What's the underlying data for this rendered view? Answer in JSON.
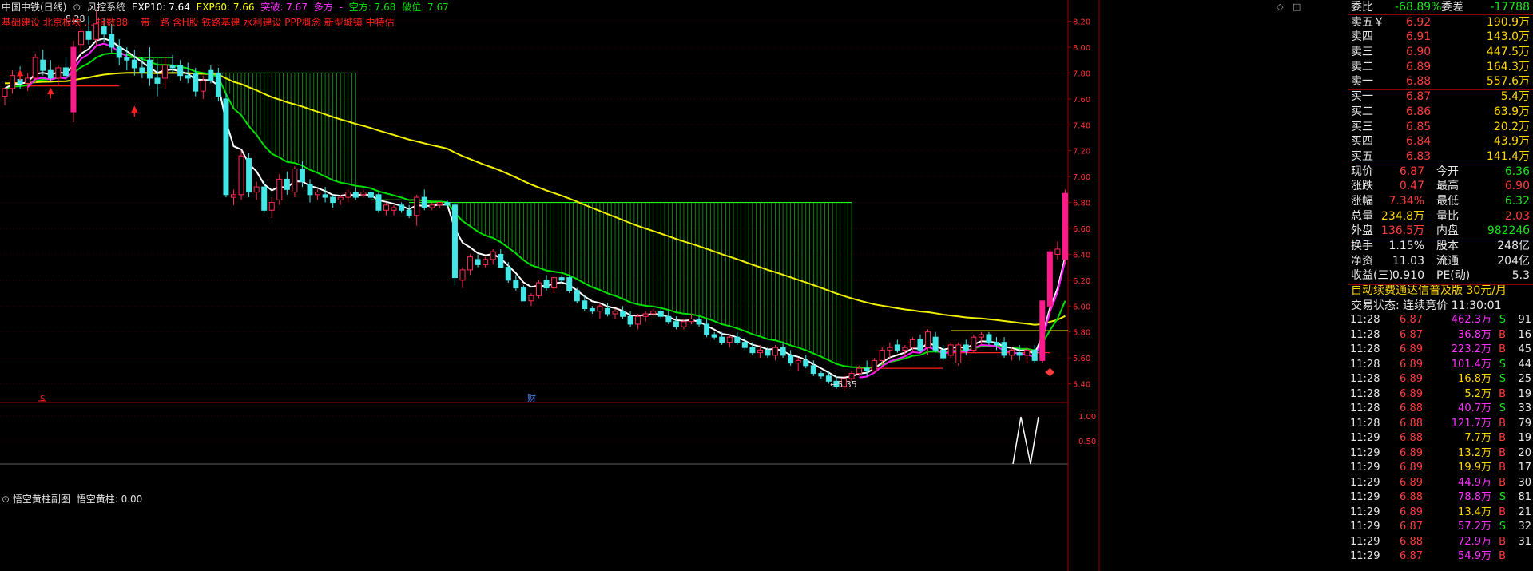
{
  "header": {
    "symbol": "中国中铁(日线)",
    "system": "风控系统",
    "exp10": "EXP10: 7.64",
    "exp60": "EXP60: 7.66",
    "breakout": "突破: 7.67",
    "bull": "多方",
    "dash": "-",
    "bear": "空方: 7.68",
    "broken": "破位: 7.67"
  },
  "concepts": "基础建设 北京板块 ... 指数88 一带一路 含H股 铁路基建 水利建设 PPP概念 新型城镇 中特估",
  "subchart": {
    "name": "悟空黄柱副图",
    "indicator": "悟空黄柱: 0.00"
  },
  "marks": {
    "s_marker": "S",
    "cai_marker": "财",
    "low_label": "←5.35",
    "high_label": "8.28"
  },
  "axis": {
    "main_ticks": [
      "8.20",
      "8.00",
      "7.80",
      "7.60",
      "7.40",
      "7.20",
      "7.00",
      "6.80",
      "6.60",
      "6.40",
      "6.20",
      "6.00",
      "5.80",
      "5.60",
      "5.40"
    ],
    "sub_ticks": [
      "1.00",
      "0.50"
    ]
  },
  "panel": {
    "weibi": {
      "label": "委比",
      "value": "-68.89%",
      "label2": "委差",
      "value2": "-17788"
    },
    "asks": [
      {
        "label": "卖五￥",
        "price": "6.92",
        "vol": "190.9万"
      },
      {
        "label": "卖四",
        "price": "6.91",
        "vol": "143.0万"
      },
      {
        "label": "卖三",
        "price": "6.90",
        "vol": "447.5万"
      },
      {
        "label": "卖二",
        "price": "6.89",
        "vol": "164.3万"
      },
      {
        "label": "卖一",
        "price": "6.88",
        "vol": "557.6万"
      }
    ],
    "bids": [
      {
        "label": "买一",
        "price": "6.87",
        "vol": "5.4万"
      },
      {
        "label": "买二",
        "price": "6.86",
        "vol": "63.9万"
      },
      {
        "label": "买三",
        "price": "6.85",
        "vol": "20.2万"
      },
      {
        "label": "买四",
        "price": "6.84",
        "vol": "43.9万"
      },
      {
        "label": "买五",
        "price": "6.83",
        "vol": "141.4万"
      }
    ],
    "quote": [
      {
        "l1": "现价",
        "v1": "6.87",
        "c1": "red",
        "l2": "今开",
        "v2": "6.36",
        "c2": "green"
      },
      {
        "l1": "涨跌",
        "v1": "0.47",
        "c1": "red",
        "l2": "最高",
        "v2": "6.90",
        "c2": "red"
      },
      {
        "l1": "涨幅",
        "v1": "7.34%",
        "c1": "red",
        "l2": "最低",
        "v2": "6.32",
        "c2": "green"
      },
      {
        "l1": "总量",
        "v1": "234.8万",
        "c1": "yellow",
        "l2": "量比",
        "v2": "2.03",
        "c2": "red"
      },
      {
        "l1": "外盘",
        "v1": "136.5万",
        "c1": "red",
        "l2": "内盘",
        "v2": "98224б",
        "c2": "green"
      }
    ],
    "fund": [
      {
        "l1": "换手",
        "v1": "1.15%",
        "l2": "股本",
        "v2": "248亿"
      },
      {
        "l1": "净资",
        "v1": "11.03",
        "l2": "流通",
        "v2": "204亿"
      },
      {
        "l1": "收益(三)",
        "v1": "0.910",
        "l2": "PE(动)",
        "v2": "5.3"
      }
    ],
    "promo": "自动续费通达信普及版  30元/月",
    "status": "交易状态: 连续竞价 11:30:01",
    "trades": [
      {
        "t": "11:28",
        "p": "6.87",
        "v": "462.3万",
        "s": "S",
        "n": "91",
        "vc": "mag"
      },
      {
        "t": "11:28",
        "p": "6.87",
        "v": "36.8万",
        "s": "B",
        "n": "16",
        "vc": "mag"
      },
      {
        "t": "11:28",
        "p": "6.89",
        "v": "223.2万",
        "s": "B",
        "n": "45",
        "vc": "mag"
      },
      {
        "t": "11:28",
        "p": "6.89",
        "v": "101.4万",
        "s": "S",
        "n": "44",
        "vc": "mag"
      },
      {
        "t": "11:28",
        "p": "6.89",
        "v": "16.8万",
        "s": "S",
        "n": "25",
        "vc": "yellow"
      },
      {
        "t": "11:28",
        "p": "6.89",
        "v": "5.2万",
        "s": "B",
        "n": "19",
        "vc": "yellow"
      },
      {
        "t": "11:28",
        "p": "6.88",
        "v": "40.7万",
        "s": "S",
        "n": "33",
        "vc": "mag"
      },
      {
        "t": "11:28",
        "p": "6.88",
        "v": "121.7万",
        "s": "B",
        "n": "79",
        "vc": "mag"
      },
      {
        "t": "11:29",
        "p": "6.88",
        "v": "7.7万",
        "s": "B",
        "n": "19",
        "vc": "yellow"
      },
      {
        "t": "11:29",
        "p": "6.89",
        "v": "13.2万",
        "s": "B",
        "n": "20",
        "vc": "yellow"
      },
      {
        "t": "11:29",
        "p": "6.89",
        "v": "19.9万",
        "s": "B",
        "n": "17",
        "vc": "yellow"
      },
      {
        "t": "11:29",
        "p": "6.89",
        "v": "44.9万",
        "s": "B",
        "n": "30",
        "vc": "mag"
      },
      {
        "t": "11:29",
        "p": "6.88",
        "v": "78.8万",
        "s": "S",
        "n": "81",
        "vc": "mag"
      },
      {
        "t": "11:29",
        "p": "6.89",
        "v": "13.4万",
        "s": "B",
        "n": "21",
        "vc": "yellow"
      },
      {
        "t": "11:29",
        "p": "6.87",
        "v": "57.2万",
        "s": "S",
        "n": "32",
        "vc": "mag"
      },
      {
        "t": "11:29",
        "p": "6.88",
        "v": "72.9万",
        "s": "B",
        "n": "31",
        "vc": "mag"
      },
      {
        "t": "11:29",
        "p": "6.87",
        "v": "54.9万",
        "s": "B",
        "n": "",
        "vc": "mag"
      }
    ]
  },
  "chart_data": {
    "type": "candlestick",
    "y_range": [
      5.28,
      8.29
    ],
    "last_close": 6.87,
    "candles": [
      [
        7.62,
        7.68,
        7.55,
        7.68
      ],
      [
        7.68,
        7.82,
        7.64,
        7.78
      ],
      [
        7.75,
        7.85,
        7.68,
        7.72
      ],
      [
        7.72,
        7.8,
        7.66,
        7.76
      ],
      [
        7.76,
        7.95,
        7.72,
        7.92
      ],
      [
        7.9,
        7.98,
        7.78,
        7.82
      ],
      [
        7.82,
        7.9,
        7.74,
        7.76
      ],
      [
        7.76,
        7.86,
        7.7,
        7.84
      ],
      [
        7.84,
        7.92,
        7.76,
        7.78
      ],
      [
        7.5,
        8.05,
        7.42,
        8.0
      ],
      [
        8.02,
        8.18,
        7.96,
        8.12
      ],
      [
        8.12,
        8.24,
        8.02,
        8.06
      ],
      [
        8.06,
        8.28,
        8.0,
        8.18
      ],
      [
        8.16,
        8.22,
        8.04,
        8.1
      ],
      [
        8.1,
        8.18,
        7.96,
        8.0
      ],
      [
        8.0,
        8.06,
        7.86,
        7.92
      ],
      [
        7.92,
        8.0,
        7.82,
        7.9
      ],
      [
        7.9,
        7.98,
        7.78,
        7.84
      ],
      [
        7.84,
        7.92,
        7.76,
        7.8
      ],
      [
        7.9,
        8.0,
        7.7,
        7.76
      ],
      [
        7.76,
        7.88,
        7.62,
        7.72
      ],
      [
        7.76,
        7.92,
        7.68,
        7.86
      ],
      [
        7.86,
        7.94,
        7.8,
        7.84
      ],
      [
        7.86,
        7.9,
        7.74,
        7.78
      ],
      [
        7.78,
        7.88,
        7.72,
        7.76
      ],
      [
        7.8,
        7.84,
        7.62,
        7.66
      ],
      [
        7.66,
        7.78,
        7.6,
        7.74
      ],
      [
        7.82,
        7.86,
        7.72,
        7.74
      ],
      [
        7.8,
        7.84,
        7.58,
        7.62
      ],
      [
        7.6,
        7.64,
        6.84,
        6.86
      ],
      [
        6.84,
        6.9,
        6.78,
        6.86
      ],
      [
        6.86,
        7.2,
        6.82,
        7.16
      ],
      [
        7.14,
        7.18,
        6.84,
        6.88
      ],
      [
        6.88,
        6.96,
        6.82,
        6.92
      ],
      [
        6.92,
        6.96,
        6.72,
        6.74
      ],
      [
        6.74,
        6.84,
        6.68,
        6.8
      ],
      [
        6.82,
        7.02,
        6.78,
        6.98
      ],
      [
        6.98,
        7.04,
        6.86,
        6.9
      ],
      [
        6.88,
        7.08,
        6.84,
        7.06
      ],
      [
        7.06,
        7.12,
        6.92,
        6.96
      ],
      [
        6.94,
        6.98,
        6.8,
        6.86
      ],
      [
        6.86,
        6.9,
        6.82,
        6.88
      ],
      [
        6.86,
        6.92,
        6.8,
        6.84
      ],
      [
        6.84,
        6.86,
        6.76,
        6.8
      ],
      [
        6.82,
        6.86,
        6.78,
        6.84
      ],
      [
        6.84,
        6.9,
        6.8,
        6.88
      ],
      [
        6.88,
        6.92,
        6.82,
        6.84
      ],
      [
        6.86,
        6.9,
        6.84,
        6.88
      ],
      [
        6.88,
        6.9,
        6.82,
        6.84
      ],
      [
        6.86,
        6.88,
        6.72,
        6.74
      ],
      [
        6.74,
        6.8,
        6.7,
        6.78
      ],
      [
        6.74,
        6.78,
        6.7,
        6.76
      ],
      [
        6.78,
        6.8,
        6.72,
        6.74
      ],
      [
        6.74,
        6.78,
        6.68,
        6.7
      ],
      [
        6.7,
        6.86,
        6.62,
        6.84
      ],
      [
        6.84,
        6.9,
        6.74,
        6.76
      ],
      [
        6.76,
        6.8,
        6.74,
        6.78
      ],
      [
        6.78,
        6.8,
        6.76,
        6.8
      ],
      [
        6.8,
        6.82,
        6.76,
        6.78
      ],
      [
        6.78,
        6.8,
        6.16,
        6.22
      ],
      [
        6.2,
        6.3,
        6.14,
        6.28
      ],
      [
        6.28,
        6.4,
        6.24,
        6.38
      ],
      [
        6.36,
        6.4,
        6.3,
        6.32
      ],
      [
        6.32,
        6.38,
        6.3,
        6.36
      ],
      [
        6.36,
        6.44,
        6.32,
        6.42
      ],
      [
        6.4,
        6.44,
        6.3,
        6.3
      ],
      [
        6.3,
        6.34,
        6.18,
        6.2
      ],
      [
        6.2,
        6.24,
        6.12,
        6.14
      ],
      [
        6.14,
        6.16,
        6.04,
        6.04
      ],
      [
        6.04,
        6.1,
        6.0,
        6.08
      ],
      [
        6.08,
        6.2,
        6.06,
        6.18
      ],
      [
        6.2,
        6.24,
        6.12,
        6.14
      ],
      [
        6.14,
        6.24,
        6.1,
        6.22
      ],
      [
        6.22,
        6.24,
        6.18,
        6.2
      ],
      [
        6.22,
        6.24,
        6.1,
        6.12
      ],
      [
        6.12,
        6.14,
        6.02,
        6.04
      ],
      [
        6.04,
        6.08,
        5.96,
        5.98
      ],
      [
        5.98,
        6.0,
        5.94,
        5.96
      ],
      [
        5.96,
        6.02,
        5.9,
        6.0
      ],
      [
        5.98,
        6.02,
        5.92,
        5.94
      ],
      [
        5.94,
        5.98,
        5.9,
        5.96
      ],
      [
        5.96,
        6.0,
        5.9,
        5.92
      ],
      [
        5.92,
        5.96,
        5.84,
        5.86
      ],
      [
        5.86,
        5.94,
        5.82,
        5.92
      ],
      [
        5.92,
        5.96,
        5.88,
        5.94
      ],
      [
        5.94,
        5.98,
        5.92,
        5.96
      ],
      [
        5.96,
        5.98,
        5.9,
        5.92
      ],
      [
        5.92,
        5.96,
        5.86,
        5.88
      ],
      [
        5.88,
        5.92,
        5.82,
        5.84
      ],
      [
        5.84,
        5.9,
        5.82,
        5.88
      ],
      [
        5.88,
        5.94,
        5.86,
        5.9
      ],
      [
        5.9,
        5.92,
        5.84,
        5.86
      ],
      [
        5.86,
        5.9,
        5.76,
        5.78
      ],
      [
        5.78,
        5.8,
        5.74,
        5.76
      ],
      [
        5.76,
        5.8,
        5.7,
        5.72
      ],
      [
        5.72,
        5.78,
        5.68,
        5.76
      ],
      [
        5.76,
        5.8,
        5.7,
        5.72
      ],
      [
        5.72,
        5.76,
        5.66,
        5.68
      ],
      [
        5.68,
        5.72,
        5.62,
        5.64
      ],
      [
        5.64,
        5.7,
        5.6,
        5.66
      ],
      [
        5.66,
        5.68,
        5.6,
        5.62
      ],
      [
        5.62,
        5.7,
        5.58,
        5.68
      ],
      [
        5.68,
        5.72,
        5.6,
        5.62
      ],
      [
        5.62,
        5.66,
        5.54,
        5.56
      ],
      [
        5.56,
        5.6,
        5.5,
        5.58
      ],
      [
        5.58,
        5.62,
        5.52,
        5.54
      ],
      [
        5.54,
        5.58,
        5.46,
        5.48
      ],
      [
        5.48,
        5.5,
        5.44,
        5.46
      ],
      [
        5.46,
        5.5,
        5.4,
        5.42
      ],
      [
        5.42,
        5.46,
        5.36,
        5.38
      ],
      [
        5.38,
        5.46,
        5.35,
        5.44
      ],
      [
        5.44,
        5.5,
        5.42,
        5.48
      ],
      [
        5.48,
        5.54,
        5.46,
        5.52
      ],
      [
        5.52,
        5.58,
        5.46,
        5.5
      ],
      [
        5.5,
        5.6,
        5.48,
        5.58
      ],
      [
        5.58,
        5.68,
        5.54,
        5.66
      ],
      [
        5.66,
        5.72,
        5.6,
        5.68
      ],
      [
        5.7,
        5.74,
        5.64,
        5.66
      ],
      [
        5.66,
        5.7,
        5.62,
        5.68
      ],
      [
        5.68,
        5.76,
        5.64,
        5.74
      ],
      [
        5.74,
        5.78,
        5.64,
        5.66
      ],
      [
        5.68,
        5.82,
        5.62,
        5.8
      ],
      [
        5.76,
        5.8,
        5.64,
        5.66
      ],
      [
        5.66,
        5.7,
        5.58,
        5.6
      ],
      [
        5.62,
        5.72,
        5.6,
        5.7
      ],
      [
        5.56,
        5.72,
        5.54,
        5.7
      ],
      [
        5.7,
        5.74,
        5.62,
        5.66
      ],
      [
        5.66,
        5.78,
        5.64,
        5.76
      ],
      [
        5.76,
        5.8,
        5.7,
        5.78
      ],
      [
        5.78,
        5.8,
        5.7,
        5.72
      ],
      [
        5.72,
        5.76,
        5.66,
        5.7
      ],
      [
        5.72,
        5.76,
        5.6,
        5.62
      ],
      [
        5.62,
        5.68,
        5.58,
        5.66
      ],
      [
        5.64,
        5.7,
        5.58,
        5.62
      ],
      [
        5.62,
        5.68,
        5.56,
        5.66
      ],
      [
        5.66,
        5.7,
        5.56,
        5.58
      ],
      [
        5.58,
        6.04,
        5.56,
        6.04
      ],
      [
        6.0,
        6.44,
        5.94,
        6.42
      ],
      [
        6.4,
        6.5,
        6.36,
        6.44
      ],
      [
        6.36,
        6.9,
        6.32,
        6.87
      ]
    ]
  },
  "colors": {
    "up": "#ff2a55",
    "down": "#44e6e6",
    "grid": "#3a0000",
    "axis": "#a00000",
    "ma_white": "#ffffff",
    "ma_green": "#00e000",
    "ma_yellow": "#f0f000",
    "ma_magenta": "#ff1aff",
    "fill_green": "#1aff1a"
  }
}
